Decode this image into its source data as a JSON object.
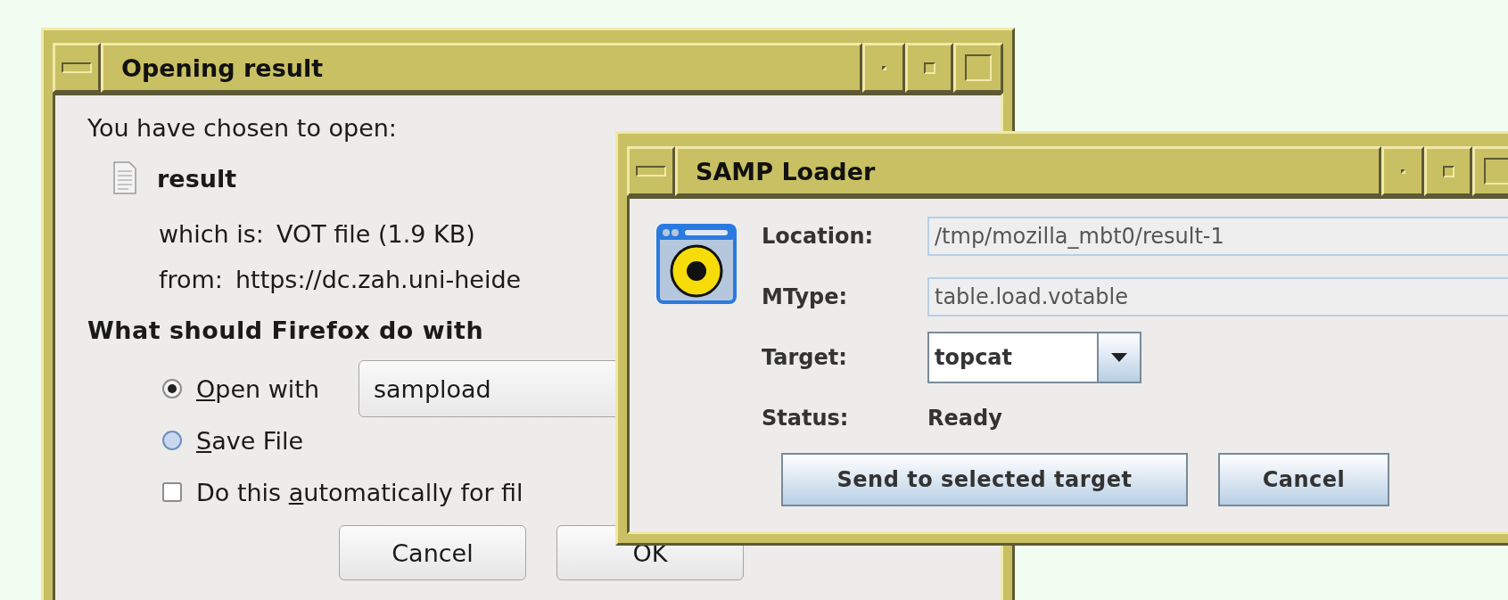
{
  "opening_dialog": {
    "title": "Opening result",
    "intro": "You have chosen to open:",
    "file_name": "result",
    "which_is_label": "which is:",
    "which_is": "VOT file (1.9 KB)",
    "from_label": "from:",
    "from": "https://dc.zah.uni-heide",
    "question": "What should Firefox do with",
    "options": [
      {
        "kind": "radio",
        "access_key": "O",
        "label_end": "pen with",
        "selected": true,
        "app": "sampload"
      },
      {
        "kind": "radio",
        "access_key": "S",
        "label_end": "ave File",
        "selected": false
      },
      {
        "kind": "checkbox",
        "label_start": "Do this ",
        "access_key": "a",
        "label_end": "utomatically for fil",
        "checked": false
      }
    ],
    "buttons": [
      "Cancel",
      "OK"
    ]
  },
  "samp_loader": {
    "title": "SAMP Loader",
    "fields": [
      {
        "kind": "text",
        "label": "Location:",
        "value": "/tmp/mozilla_mbt0/result-1"
      },
      {
        "kind": "text",
        "label": "MType:",
        "value": "table.load.votable"
      },
      {
        "kind": "combo",
        "label": "Target:",
        "value": "topcat"
      },
      {
        "kind": "status",
        "label": "Status:",
        "value": "Ready"
      }
    ],
    "buttons": [
      "Send to selected target",
      "Cancel"
    ]
  }
}
